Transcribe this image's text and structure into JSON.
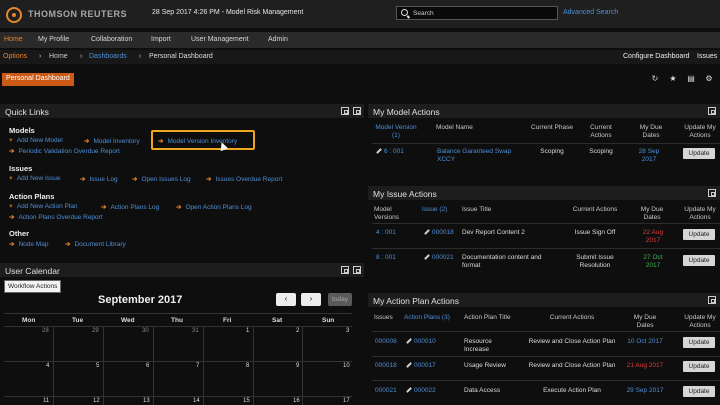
{
  "header": {
    "brand": "THOMSON REUTERS",
    "datetime": "28 Sep 2017 4:26 PM - Model Risk Management",
    "search_placeholder": "Search",
    "advanced_search": "Advanced Search"
  },
  "nav": {
    "items": [
      "Home",
      "My Profile",
      "Collaboration",
      "Import",
      "User Management",
      "Admin"
    ]
  },
  "subnav": {
    "options": "Options",
    "crumb_home": "Home",
    "crumb_dashboards": "Dashboards",
    "crumb_current": "Personal Dashboard",
    "configure": "Configure Dashboard",
    "issues": "Issues"
  },
  "dashboard_tab": "Personal Dashboard",
  "quick_links": {
    "title": "Quick Links",
    "models_label": "Models",
    "models": [
      "Add New Model",
      "Model Inventory",
      "Model Version Inventory",
      "Periodic Validation Overdue Report"
    ],
    "issues_label": "Issues",
    "issues": [
      "Add New Issue",
      "Issue Log",
      "Open Issues Log",
      "Issues Overdue Report"
    ],
    "action_plans_label": "Action Plans",
    "action_plans": [
      "Add New Action Plan",
      "Action Plans Log",
      "Open Action Plans Log",
      "Action Plans Overdue Report"
    ],
    "other_label": "Other",
    "other": [
      "Node Map",
      "Document Library"
    ]
  },
  "calendar": {
    "title": "User Calendar",
    "tab": "Workflow Actions",
    "month": "September 2017",
    "today": "today",
    "prev": "‹",
    "next": "›",
    "days": [
      "Mon",
      "Tue",
      "Wed",
      "Thu",
      "Fri",
      "Sat",
      "Sun"
    ],
    "week1": [
      "28",
      "29",
      "30",
      "31",
      "1",
      "2",
      "3"
    ],
    "week2": [
      "4",
      "5",
      "6",
      "7",
      "8",
      "9",
      "10"
    ],
    "week3": [
      "11",
      "12",
      "13",
      "14",
      "15",
      "16",
      "17"
    ]
  },
  "model_actions": {
    "title": "My Model Actions",
    "headers": [
      "Model Version (1)",
      "Model Name",
      "Current Phase",
      "Current Actions",
      "My Due Dates",
      "Update My Actions"
    ],
    "rows": [
      {
        "version": "6 : 001",
        "name": "Balance Garanteed Swap XCCY",
        "phase": "Scoping",
        "action": "Scoping",
        "due": "28 Sep 2017",
        "update": "Update"
      }
    ]
  },
  "issue_actions": {
    "title": "My Issue Actions",
    "headers": [
      "Model Versions",
      "Issue (2)",
      "Issue Title",
      "Current Actions",
      "My Due Dates",
      "Update My Actions"
    ],
    "rows": [
      {
        "version": "4 : 001",
        "issue": "000018",
        "title": "Dev Report Content 2",
        "action": "Issue Sign Off",
        "due": "22 Aug 2017",
        "update": "Update"
      },
      {
        "version": "8 : 001",
        "issue": "000021",
        "title": "Documentation content and format",
        "action": "Submit Issue Resolution",
        "due": "27 Oct 2017",
        "update": "Update"
      }
    ]
  },
  "action_plan_actions": {
    "title": "My Action Plan Actions",
    "headers": [
      "Issues",
      "Action Plans (3)",
      "Action Plan Title",
      "Current Actions",
      "My Due Dates",
      "Update My Actions"
    ],
    "rows": [
      {
        "issue": "000008",
        "plan": "000010",
        "title": "Resource Increase",
        "action": "Review and Close Action Plan",
        "due": "10 Oct 2017",
        "update": "Update"
      },
      {
        "issue": "000018",
        "plan": "000017",
        "title": "Usage Review",
        "action": "Review and Close Action Plan",
        "due": "21 Aug 2017",
        "update": "Update"
      },
      {
        "issue": "000021",
        "plan": "000022",
        "title": "Data Access",
        "action": "Execute Action Plan",
        "due": "29 Sep 2017",
        "update": "Update"
      }
    ]
  },
  "colors": {
    "accent": "#e8862b",
    "link": "#4e8fd6",
    "overdue": "#e03c3c",
    "ontrack": "#3fb34f"
  }
}
